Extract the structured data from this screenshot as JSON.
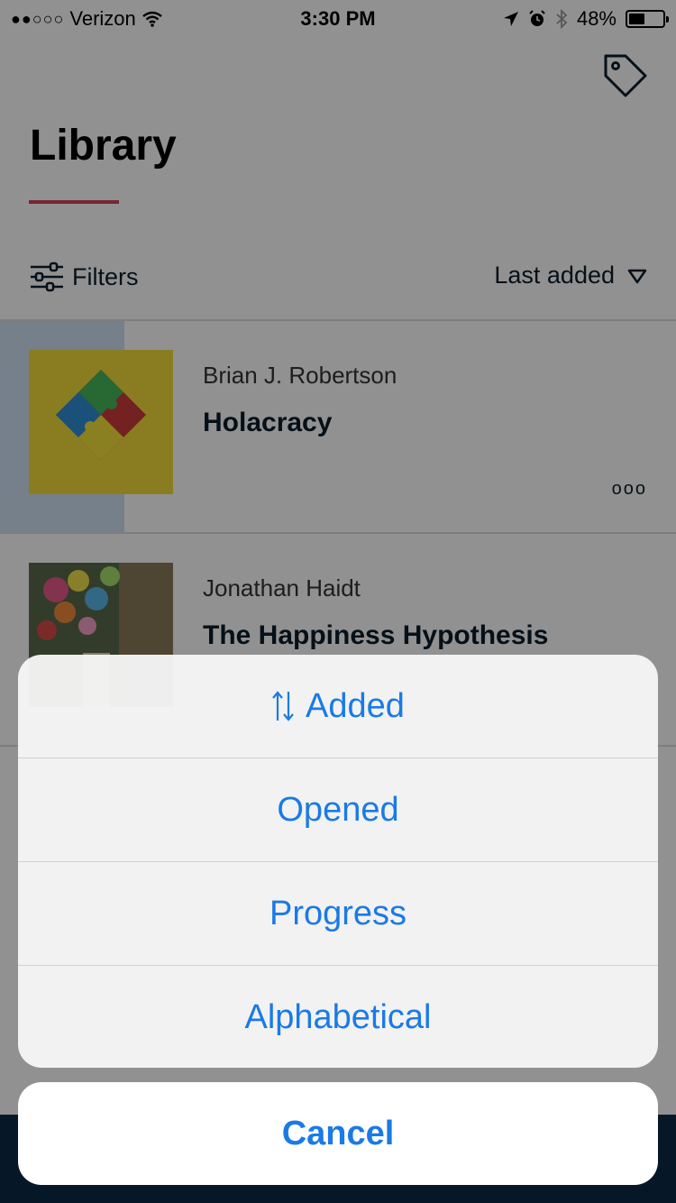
{
  "status_bar": {
    "carrier": "Verizon",
    "signal": "●●○○○",
    "time": "3:30 PM",
    "battery": "48%",
    "battery_level": 0.48
  },
  "header": {
    "title": "Library"
  },
  "toolbar": {
    "filters_label": "Filters",
    "sort_label": "Last added"
  },
  "books": [
    {
      "author": "Brian J. Robertson",
      "title": "Holacracy",
      "more": "ooo"
    },
    {
      "author": "Jonathan Haidt",
      "title": "The Happiness Hypothesis"
    }
  ],
  "sort_sheet": {
    "options": [
      "Added",
      "Opened",
      "Progress",
      "Alphabetical"
    ],
    "cancel_label": "Cancel"
  },
  "colors": {
    "accent": "#1a7ae6",
    "underline": "#d3415b",
    "bottom_bar": "#0b2b45",
    "selection": "#cfe1f2"
  }
}
